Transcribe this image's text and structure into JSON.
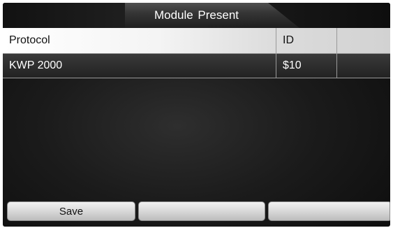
{
  "header": {
    "title": "Module  Present"
  },
  "table": {
    "columns": [
      "Protocol",
      "ID",
      ""
    ],
    "rows": [
      [
        "KWP 2000",
        "$10",
        ""
      ]
    ]
  },
  "footer": {
    "buttons": [
      "Save",
      "",
      ""
    ]
  }
}
